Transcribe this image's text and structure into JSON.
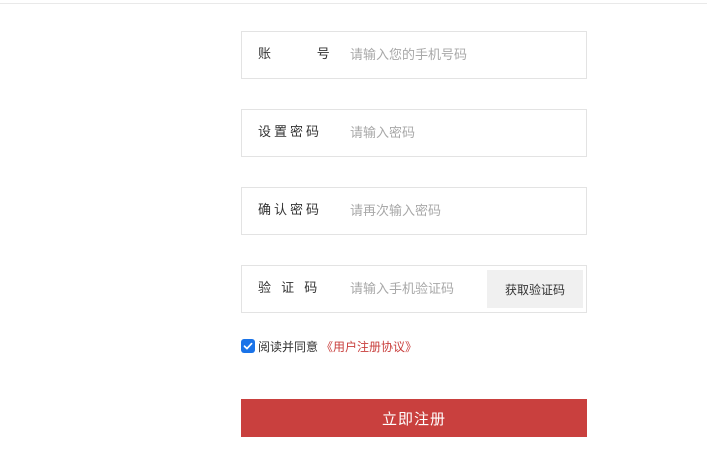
{
  "form": {
    "account": {
      "label": "账      号",
      "placeholder": "请输入您的手机号码",
      "value": ""
    },
    "password": {
      "label": "设置密码",
      "placeholder": "请输入密码",
      "value": ""
    },
    "confirm_password": {
      "label": "确认密码",
      "placeholder": "请再次输入密码",
      "value": ""
    },
    "verification": {
      "label": "验 证 码",
      "placeholder": "请输入手机验证码",
      "value": "",
      "button_label": "获取验证码"
    }
  },
  "agreement": {
    "checked": true,
    "text": "阅读并同意",
    "link_text": "《用户注册协议》"
  },
  "submit_label": "立即注册",
  "colors": {
    "accent": "#c9403e",
    "checkbox": "#1a73e8",
    "border": "#e3e3e3",
    "code_button_bg": "#f0f0f0",
    "placeholder": "#a8a8a8"
  },
  "icons": {
    "checkbox": "checkmark-icon"
  }
}
